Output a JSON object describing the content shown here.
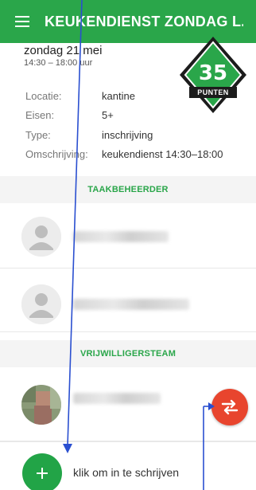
{
  "appbar": {
    "title": "KEUKENDIENST ZONDAG L...",
    "menu_icon": "hamburger-menu-icon"
  },
  "event": {
    "date": "zondag 21 mei",
    "time": "14:30 – 18:00 uur",
    "points": "35",
    "points_label": "PUNTEN"
  },
  "details": [
    {
      "label": "Locatie:",
      "value": "kantine"
    },
    {
      "label": "Eisen:",
      "value": "5+"
    },
    {
      "label": "Type:",
      "value": "inschrijving"
    },
    {
      "label": "Omschrijving:",
      "value": "keukendienst 14:30–18:00"
    }
  ],
  "sections": {
    "task_manager": "TAAKBEHEERDER",
    "volunteer_team": "VRIJWILLIGERSTEAM"
  },
  "signup": {
    "label": "klik om in te schrijven",
    "icon": "plus-icon"
  },
  "colors": {
    "brand_green": "#2aa64a",
    "badge_dark": "#1c1c1c",
    "swap_red": "#e8452e",
    "annotation_blue": "#2a4fd0"
  }
}
